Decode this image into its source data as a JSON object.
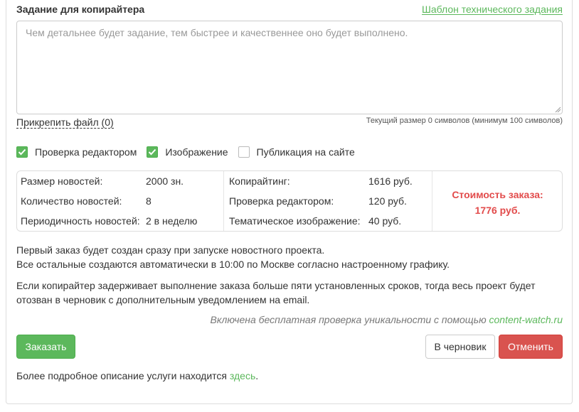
{
  "header": {
    "title": "Задание для копирайтера",
    "template_link": "Шаблон технического задания"
  },
  "task": {
    "placeholder": "Чем детальнее будет задание, тем быстрее и качественнее оно будет выполнено.",
    "value": ""
  },
  "attach_label": "Прикрепить файл (0)",
  "size_info": "Текущий размер 0 символов (минимум 100 символов)",
  "options": [
    {
      "label": "Проверка редактором",
      "checked": true
    },
    {
      "label": "Изображение",
      "checked": true
    },
    {
      "label": "Публикация на сайте",
      "checked": false
    }
  ],
  "summary": {
    "params": [
      {
        "label": "Размер новостей:",
        "value": "2000 зн."
      },
      {
        "label": "Количество новостей:",
        "value": "8"
      },
      {
        "label": "Периодичность новостей:",
        "value": "2 в неделю"
      }
    ],
    "costs": [
      {
        "label": "Копирайтинг:",
        "value": "1616 руб."
      },
      {
        "label": "Проверка редактором:",
        "value": "120 руб."
      },
      {
        "label": "Тематическое изображение:",
        "value": "40 руб."
      }
    ],
    "total_label": "Стоимость заказа:",
    "total_value": "1776 руб."
  },
  "notes": {
    "line1": "Первый заказ будет создан сразу при запуске новостного проекта.",
    "line2": "Все остальные создаются автоматически в 10:00 по Москве согласно настроенному графику.",
    "line3": "Если копирайтер задерживает выполнение заказа больше пяти установленных сроков, тогда весь проект будет",
    "line4": "отозван в черновик с дополнительным уведомлением на email."
  },
  "uniqueness": {
    "text": "Включена бесплатная проверка уникальности с помощью ",
    "link": "content-watch.ru"
  },
  "buttons": {
    "order": "Заказать",
    "draft": "В черновик",
    "cancel": "Отменить"
  },
  "footer": {
    "text": "Более подробное описание услуги находится ",
    "link": "здесь",
    "end": "."
  },
  "colors": {
    "accent": "#5cb85c",
    "danger": "#d9534f",
    "total": "#e24b4b"
  }
}
